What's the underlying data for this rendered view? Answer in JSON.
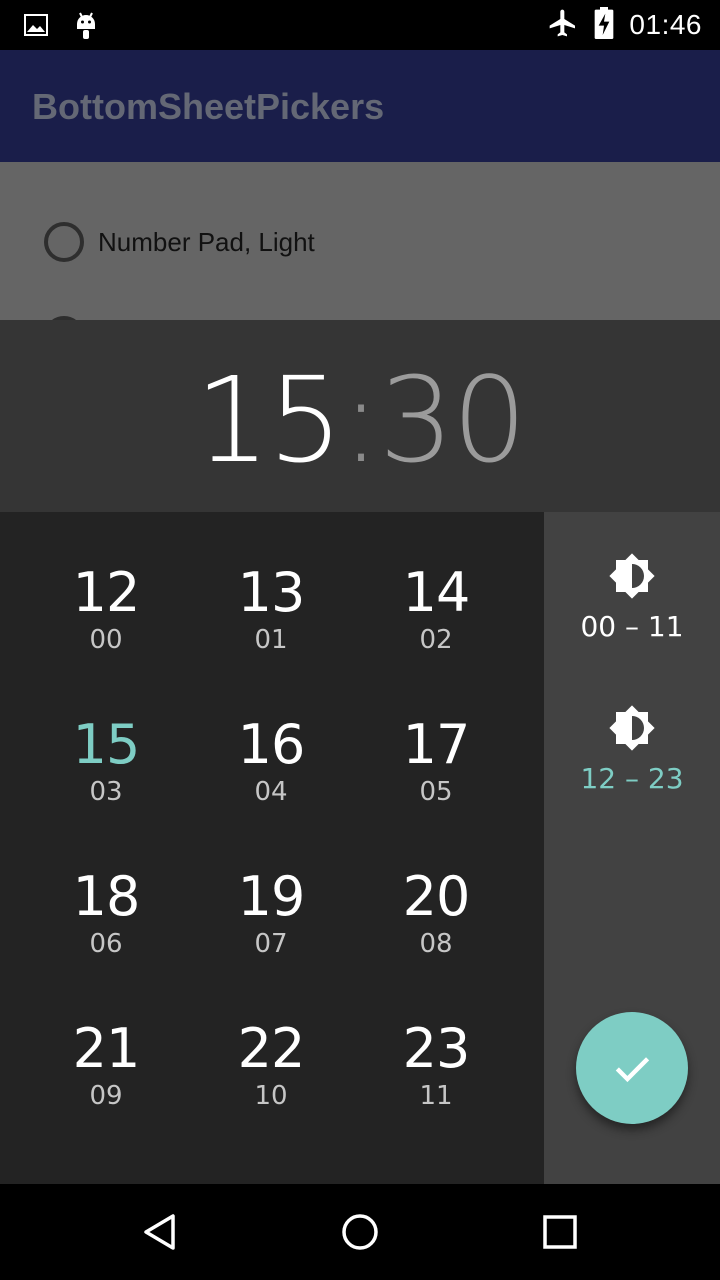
{
  "status_bar": {
    "time": "01:46",
    "left_icons": [
      "image-icon",
      "android-icon"
    ],
    "right_icons": [
      "airplane-mode-icon",
      "battery-charging-icon"
    ]
  },
  "app_bar": {
    "title": "BottomSheetPickers"
  },
  "content": {
    "radio_options": [
      {
        "label": "Number Pad, Light",
        "selected": false
      }
    ]
  },
  "time_picker": {
    "hours": "15",
    "separator": ":",
    "minutes": "30",
    "accent_color": "#7ecdc4",
    "grid": [
      {
        "hour24": "12",
        "hour12": "00"
      },
      {
        "hour24": "13",
        "hour12": "01"
      },
      {
        "hour24": "14",
        "hour12": "02"
      },
      {
        "hour24": "15",
        "hour12": "03",
        "selected": true
      },
      {
        "hour24": "16",
        "hour12": "04"
      },
      {
        "hour24": "17",
        "hour12": "05"
      },
      {
        "hour24": "18",
        "hour12": "06"
      },
      {
        "hour24": "19",
        "hour12": "07"
      },
      {
        "hour24": "20",
        "hour12": "08"
      },
      {
        "hour24": "21",
        "hour12": "09"
      },
      {
        "hour24": "22",
        "hour12": "10"
      },
      {
        "hour24": "23",
        "hour12": "11"
      }
    ],
    "half_day_options": [
      {
        "label": "00 – 11",
        "icon": "brightness-half-icon",
        "active": false
      },
      {
        "label": "12 – 23",
        "icon": "brightness-half-icon",
        "active": true
      }
    ],
    "confirm_icon": "check-icon"
  },
  "nav_bar": {
    "buttons": [
      "back-icon",
      "home-icon",
      "recents-icon"
    ]
  }
}
